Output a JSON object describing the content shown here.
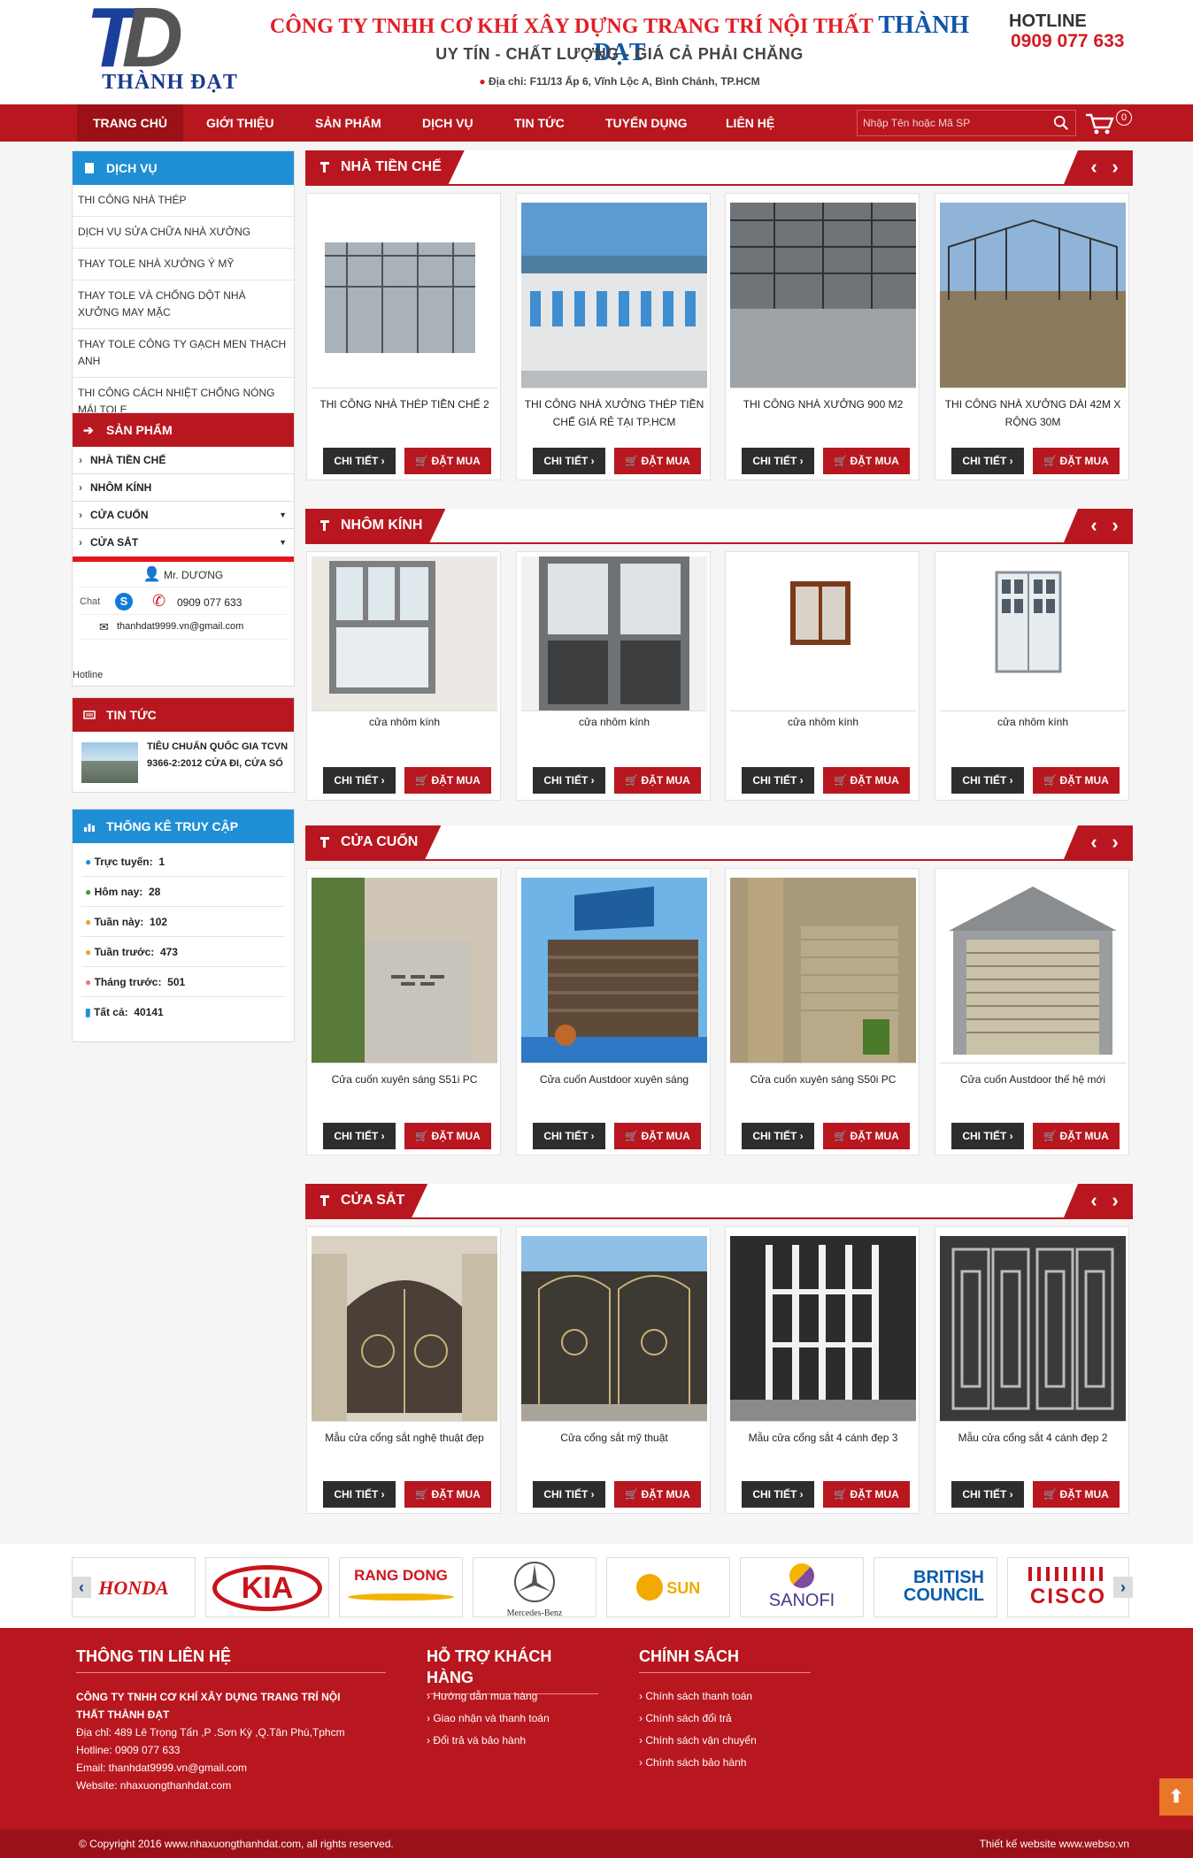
{
  "header": {
    "logo_text": "THÀNH ĐẠT",
    "company_prefix": "CÔNG TY TNHH CƠ KHÍ XÂY DỰNG TRANG TRÍ NỘI THẤT",
    "company_brand": "THÀNH ĐẠT",
    "slogan": "UY TÍN - CHẤT LƯỢNG - GIÁ CẢ PHẢI CHĂNG",
    "address": "Địa chỉ: F11/13 Ấp 6, Vĩnh Lộc A, Bình Chánh, TP.HCM",
    "hotline_label": "HOTLINE",
    "hotline_number": "0909 077 633"
  },
  "nav": {
    "items": [
      "TRANG CHỦ",
      "GIỚI THIỆU",
      "SẢN PHẨM",
      "DỊCH VỤ",
      "TIN TỨC",
      "TUYỂN DỤNG",
      "LIÊN HỆ"
    ],
    "search_placeholder": "Nhập Tên hoặc Mã SP",
    "cart_count": "0"
  },
  "sidebar": {
    "services": {
      "title": "DỊCH VỤ",
      "items": [
        "THI CÔNG NHÀ THÉP",
        "DỊCH VỤ SỬA CHỮA NHÀ XƯỞNG",
        "THAY TOLE NHÀ XƯỞNG Ý MỸ",
        "THAY TOLE VÀ CHỐNG DỘT NHÀ XƯỞNG MAY MẶC",
        "THAY TOLE CÔNG TY GẠCH MEN THẠCH ANH",
        "THI CÔNG CÁCH NHIỆT CHỐNG NÓNG MÁI TOLE"
      ]
    },
    "products": {
      "title": "SẢN PHẨM",
      "items": [
        "NHÀ TIỀN CHẾ",
        "NHÔM KÍNH",
        "CỬA CUỐN",
        "CỬA SẮT"
      ]
    },
    "support": {
      "name": "Mr. DƯƠNG",
      "chat_alt": "Chat",
      "phone": "0909 077 633",
      "email": "thanhdat9999.vn@gmail.com",
      "label": "Hotline"
    },
    "news": {
      "title": "TIN TỨC",
      "item": "TIÊU CHUẨN QUỐC GIA TCVN 9366-2:2012 CỬA ĐI, CỬA SỔ"
    },
    "stats": {
      "title": "THỐNG KÊ TRUY CẬP",
      "rows": [
        {
          "label": "Trực tuyến:",
          "value": "1"
        },
        {
          "label": "Hôm nay:",
          "value": "28"
        },
        {
          "label": "Tuần này:",
          "value": "102"
        },
        {
          "label": "Tuần trước:",
          "value": "473"
        },
        {
          "label": "Tháng trước:",
          "value": "501"
        },
        {
          "label": "Tất cả:",
          "value": "40141"
        }
      ]
    }
  },
  "buttons": {
    "detail": "CHI TIẾT",
    "buy": "ĐẶT MUA"
  },
  "sections": [
    {
      "title": "NHÀ TIỀN CHẾ",
      "products": [
        "THI CÔNG NHÀ THÉP TIỀN CHẾ 2",
        "THI CÔNG NHÀ XƯỞNG THÉP TIỀN CHẾ GIÁ RẺ TẠI TP.HCM",
        "THI CÔNG NHÀ XƯỞNG 900 M2",
        "THI CÔNG NHÀ XƯỞNG DÀI 42M X RỘNG 30M"
      ]
    },
    {
      "title": "NHÔM KÍNH",
      "products": [
        "cửa nhôm kính",
        "cửa nhôm kính",
        "cửa nhôm kính",
        "cửa nhôm kính"
      ]
    },
    {
      "title": "CỬA CUỐN",
      "products": [
        "Cửa cuốn xuyên sáng S51i PC",
        "Cửa cuốn Austdoor xuyên sáng",
        "Cửa cuốn xuyên sáng S50i PC",
        "Cửa cuốn Austdoor thế hệ mới"
      ]
    },
    {
      "title": "CỬA SẮT",
      "products": [
        "Mẫu cửa cổng sắt nghệ thuật đẹp",
        "Cửa cổng sắt mỹ thuật",
        "Mẫu cửa cổng sắt 4 cánh đẹp 3",
        "Mẫu cửa cổng sắt 4 cánh đẹp 2"
      ]
    }
  ],
  "partners": [
    "HONDA",
    "KIA",
    "RANG DONG",
    "Mercedes-Benz",
    "SUN TRAVEL",
    "SANOFI",
    "BRITISH COUNCIL",
    "CISCO"
  ],
  "footer": {
    "contact_title": "THÔNG TIN LIÊN HỆ",
    "company": "CÔNG TY TNHH CƠ KHÍ XÂY DỰNG TRANG TRÍ NỘI THẤT THÀNH ĐẠT",
    "address": "Địa chỉ: 489 Lê Trọng Tấn ,P .Sơn Kỳ ,Q.Tân Phú,Tphcm",
    "hotline": "Hotline: 0909 077 633",
    "email": "Email: thanhdat9999.vn@gmail.com",
    "website": "Website: nhaxuongthanhdat.com",
    "support_title": "HỖ TRỢ KHÁCH HÀNG",
    "support_links": [
      "Hướng dẫn mua hàng",
      "Giao nhận và thanh toán",
      "Đổi trả và bảo hành"
    ],
    "policy_title": "CHÍNH SÁCH",
    "policy_links": [
      "Chính sách thanh toán",
      "Chính sách đổi trả",
      "Chính sách vận chuyển",
      "Chính sách bảo hành"
    ],
    "copyright": "© Copyright 2016 www.nhaxuongthanhdat.com, all rights reserved.",
    "designer": "Thiết kế website www.webso.vn"
  },
  "colors": {
    "primary_red": "#b8171f",
    "blue": "#1f8fd5",
    "brand_blue": "#1b3f9c"
  }
}
